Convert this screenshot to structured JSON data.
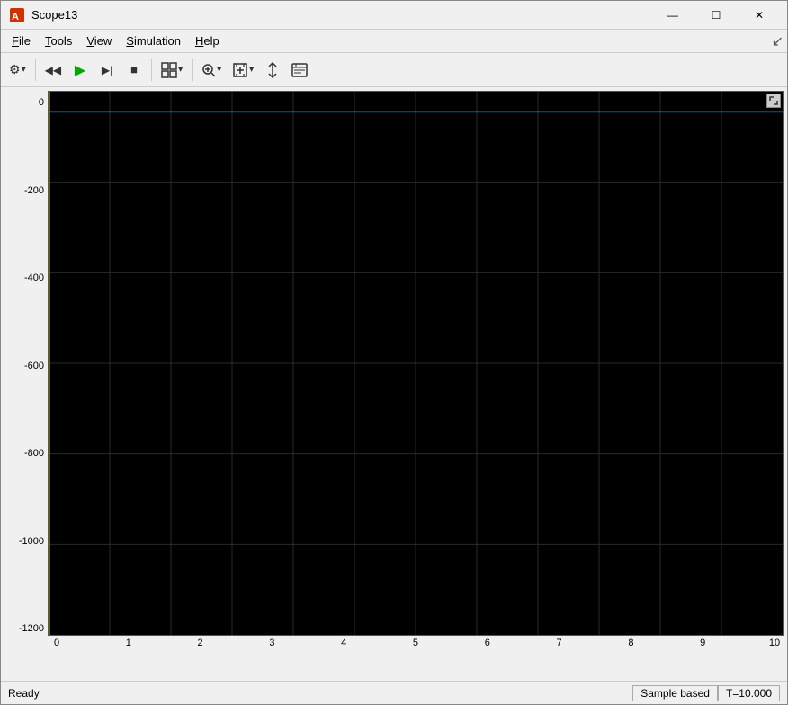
{
  "window": {
    "title": "Scope13",
    "icon": "matlab-icon"
  },
  "window_controls": {
    "minimize": "—",
    "maximize": "☐",
    "close": "✕"
  },
  "menu": {
    "items": [
      {
        "label": "File",
        "underline": "F"
      },
      {
        "label": "Tools",
        "underline": "T"
      },
      {
        "label": "View",
        "underline": "V"
      },
      {
        "label": "Simulation",
        "underline": "S"
      },
      {
        "label": "Help",
        "underline": "H"
      }
    ]
  },
  "toolbar": {
    "buttons": [
      {
        "name": "settings-btn",
        "icon": "⚙",
        "has_dropdown": true
      },
      {
        "name": "rewind-btn",
        "icon": "◀◀",
        "has_dropdown": false
      },
      {
        "name": "run-btn",
        "icon": "▶",
        "has_dropdown": false,
        "color": "#00aa00"
      },
      {
        "name": "step-btn",
        "icon": "▶|",
        "has_dropdown": false
      },
      {
        "name": "stop-btn",
        "icon": "■",
        "has_dropdown": false
      },
      {
        "name": "layout-btn",
        "icon": "⊞",
        "has_dropdown": true
      },
      {
        "name": "zoom-btn",
        "icon": "🔍",
        "has_dropdown": true
      },
      {
        "name": "fit-btn",
        "icon": "⤢",
        "has_dropdown": true
      },
      {
        "name": "cursor-btn",
        "icon": "↕",
        "has_dropdown": false
      },
      {
        "name": "config-btn",
        "icon": "📋",
        "has_dropdown": false
      }
    ]
  },
  "chart": {
    "background": "#000000",
    "y_axis": {
      "labels": [
        "0",
        "-200",
        "-400",
        "-600",
        "-800",
        "-1000",
        "-1200"
      ],
      "min": -1300,
      "max": 50
    },
    "x_axis": {
      "labels": [
        "0",
        "1",
        "2",
        "3",
        "4",
        "5",
        "6",
        "7",
        "8",
        "9",
        "10"
      ],
      "min": 0,
      "max": 10
    },
    "grid": {
      "h_lines": 7,
      "v_lines": 10
    }
  },
  "status_bar": {
    "left": "Ready",
    "segments": [
      {
        "label": "Sample based"
      },
      {
        "label": "T=10.000"
      }
    ]
  }
}
